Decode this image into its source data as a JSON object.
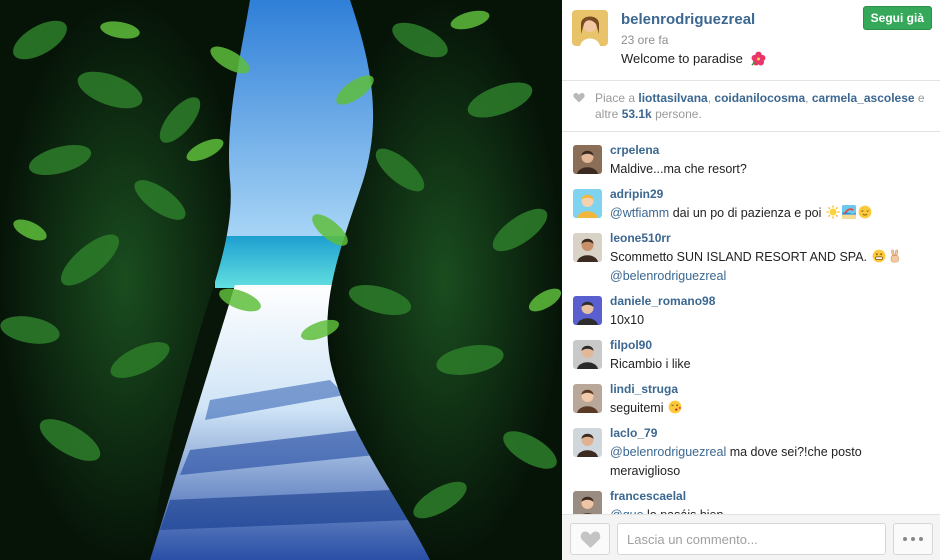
{
  "post": {
    "owner": "belenrodriguezreal",
    "time": "23 ore fa",
    "caption": "Welcome to paradise",
    "caption_emoji": "hibiscus-flower",
    "follow_label": "Segui già",
    "photo_desc_icon": "beach-path-photo"
  },
  "likes": {
    "prefix": "Piace a",
    "users": [
      "liottasilvana",
      "coidanilocosma",
      "carmela_ascolese"
    ],
    "sep": ",",
    "and_word": "e",
    "others_prefix": "altre",
    "count": "53.1k",
    "suffix": "persone."
  },
  "comments": [
    {
      "user": "crpelena",
      "parts": [
        {
          "t": "text",
          "v": "Maldive...ma che resort?"
        }
      ]
    },
    {
      "user": "adripin29",
      "parts": [
        {
          "t": "mention",
          "v": "@wtfiamm"
        },
        {
          "t": "text",
          "v": " dai un po di pazienza e poi "
        },
        {
          "t": "emoji",
          "v": "sun"
        },
        {
          "t": "emoji",
          "v": "beach"
        },
        {
          "t": "emoji",
          "v": "relieved-face"
        }
      ]
    },
    {
      "user": "leone510rr",
      "parts": [
        {
          "t": "text",
          "v": "Scommetto SUN ISLAND RESORT AND SPA. "
        },
        {
          "t": "emoji",
          "v": "grin-face"
        },
        {
          "t": "emoji",
          "v": "victory-hand"
        },
        {
          "t": "text",
          "v": " "
        },
        {
          "t": "mention",
          "v": "@belenrodriguezreal"
        }
      ]
    },
    {
      "user": "daniele_romano98",
      "parts": [
        {
          "t": "text",
          "v": "10x10"
        }
      ]
    },
    {
      "user": "filpol90",
      "parts": [
        {
          "t": "text",
          "v": "Ricambio i like"
        }
      ]
    },
    {
      "user": "lindi_struga",
      "parts": [
        {
          "t": "text",
          "v": "seguitemi "
        },
        {
          "t": "emoji",
          "v": "kiss-face"
        }
      ]
    },
    {
      "user": "laclo_79",
      "parts": [
        {
          "t": "mention",
          "v": "@belenrodriguezreal"
        },
        {
          "t": "text",
          "v": " ma dove sei?!che posto meraviglioso"
        }
      ]
    },
    {
      "user": "francescaelal",
      "parts": [
        {
          "t": "mention",
          "v": "@quo"
        },
        {
          "t": "text",
          "v": " lo pasáis bien"
        }
      ]
    }
  ],
  "footer": {
    "placeholder": "Lascia un commento...",
    "like_icon": "heart-icon",
    "more_icon": "ellipsis-icon"
  },
  "colors": {
    "link": "#3b6790",
    "follow": "#35a85a",
    "muted": "#8e8e8e"
  }
}
